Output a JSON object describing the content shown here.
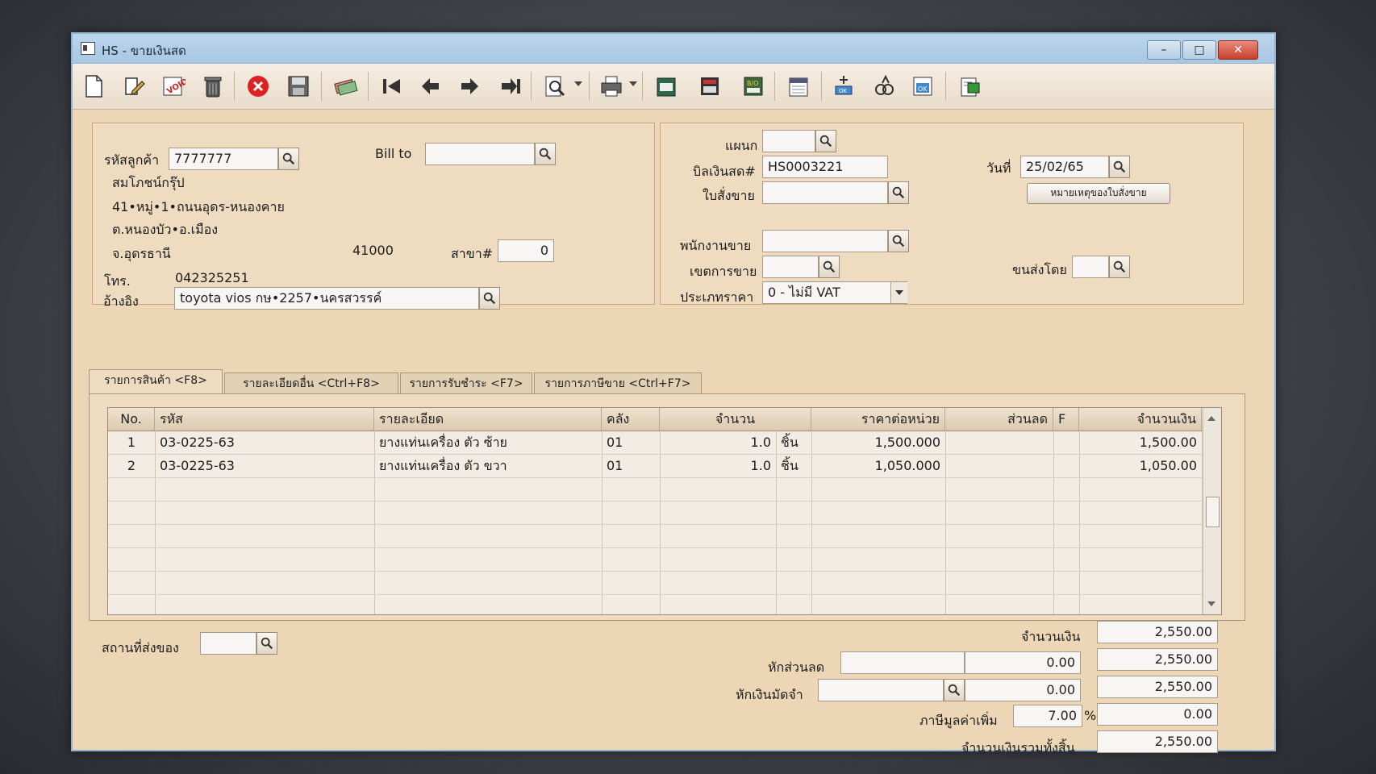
{
  "window": {
    "title": "HS - ขายเงินสด",
    "min": "–",
    "max": "□",
    "close": "✕"
  },
  "toolbar": {
    "icons": [
      "new-document-icon",
      "edit-icon",
      "void-icon",
      "trash-icon",
      "cancel-icon",
      "save-icon",
      "payment-icon",
      "first-record-icon",
      "previous-record-icon",
      "next-record-icon",
      "last-record-icon",
      "find-icon",
      "print-icon",
      "ledger-icon",
      "calculator-icon",
      "bo-report-icon",
      "calendar-report-icon",
      "approve-icon",
      "scan-icon",
      "ok-icon",
      "export-icon"
    ]
  },
  "customer": {
    "code_label": "รหัสลูกค้า",
    "code": "7777777",
    "billto_label": "Bill to",
    "billto": "",
    "name": "สมโภชน์กรุ๊ป",
    "addr1": "41•หมู่•1•ถนนอุดร-หนองคาย",
    "addr2": "ต.หนองบัว•อ.เมือง",
    "province": "จ.อุดรธานี",
    "postcode": "41000",
    "branch_label": "สาขา#",
    "branch": "0",
    "phone_label": "โทร.",
    "phone": "042325251",
    "ref_label": "อ้างอิง",
    "ref": "toyota vios กษ•2257•นครสวรรค์"
  },
  "doc": {
    "dept_label": "แผนก",
    "dept": "",
    "bill_label": "บิลเงินสด#",
    "bill": "HS0003221",
    "date_label": "วันที่",
    "date": "25/02/65",
    "so_label": "ใบสั่งขาย",
    "so": "",
    "so_note_button": "หมายเหตุของใบสั่งขาย",
    "salesman_label": "พนักงานขาย",
    "salesman": "",
    "zone_label": "เขตการขาย",
    "zone": "",
    "ship_label": "ขนส่งโดย",
    "ship": "",
    "pricetype_label": "ประเภทราคา",
    "pricetype": "0 - ไม่มี VAT"
  },
  "tabs": [
    "รายการสินค้า <F8>",
    "รายละเอียดอื่น <Ctrl+F8>",
    "รายการรับชำระ <F7>",
    "รายการภาษีขาย <Ctrl+F7>"
  ],
  "grid": {
    "headers": {
      "no": "No.",
      "code": "รหัส",
      "desc": "รายละเอียด",
      "wh": "คลัง",
      "qty": "จำนวน",
      "price": "ราคาต่อหน่วย",
      "disc": "ส่วนลด",
      "f": "F",
      "amount": "จำนวนเงิน"
    },
    "rows": [
      {
        "no": "1",
        "code": "03-0225-63",
        "desc": "ยางแท่นเครื่อง ตัว ซ้าย",
        "wh": "01",
        "qty": "1.0",
        "unit": "ชิ้น",
        "price": "1,500.000",
        "disc": "",
        "f": "",
        "amount": "1,500.00"
      },
      {
        "no": "2",
        "code": "03-0225-63",
        "desc": "ยางแท่นเครื่อง ตัว ขวา",
        "wh": "01",
        "qty": "1.0",
        "unit": "ชิ้น",
        "price": "1,050.000",
        "disc": "",
        "f": "",
        "amount": "1,050.00"
      }
    ]
  },
  "footer": {
    "delivery_label": "สถานที่ส่งของ",
    "delivery": "",
    "amount_label": "จำนวนเงิน",
    "amount": "2,550.00",
    "discount_label": "หักส่วนลด",
    "discount_text": "",
    "discount": "0.00",
    "after_discount": "2,550.00",
    "deposit_label": "หักเงินมัดจำ",
    "deposit_text": "",
    "deposit": "0.00",
    "after_deposit": "2,550.00",
    "vat_label": "ภาษีมูลค่าเพิ่ม",
    "vat_rate": "7.00",
    "vat_pct": "%",
    "vat": "0.00",
    "total_label": "จำนวนเงินรวมทั้งสิ้น",
    "total": "2,550.00"
  }
}
